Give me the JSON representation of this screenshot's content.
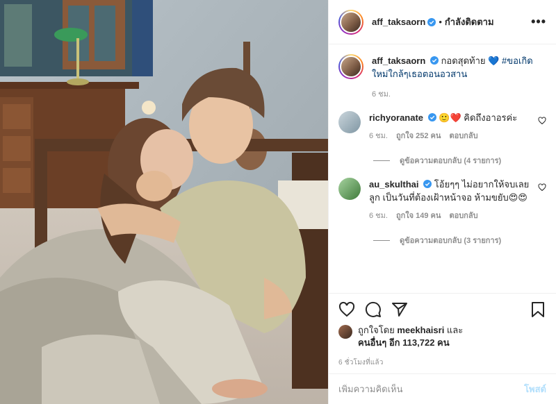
{
  "post": {
    "author": "aff_taksaorn",
    "follow_status": "กำลังติดตาม",
    "dot": "•",
    "more": "•••"
  },
  "caption": {
    "username": "aff_taksaorn",
    "text_before": "กอดสุดท้าย ",
    "heart": "💙",
    "hashtag": " #ขอเกิดใหม่ใกล้ๆเธอตอนอวสาน",
    "time": "6 ชม."
  },
  "comments": [
    {
      "username": "richyoranate",
      "text": " 🙂❤️ คิดถึงอาอรค่ะ",
      "time": "6 ชม.",
      "likes": "ถูกใจ 252 คน",
      "reply": "ตอบกลับ",
      "view_replies": "ดูข้อความตอบกลับ (4 รายการ)",
      "avatar_color": "#9fb3bf"
    },
    {
      "username": "au_skulthai",
      "text": " โอ้ยๆๆ ไม่อยากให้จบเลยลูก เป็นวันที่ต้องเฝ้าหน้าจอ ห้ามขยับ😍😍",
      "time": "6 ชม.",
      "likes": "ถูกใจ 149 คน",
      "reply": "ตอบกลับ",
      "view_replies": "ดูข้อความตอบกลับ (3 รายการ)",
      "avatar_color": "#6fa06a"
    }
  ],
  "likes": {
    "prefix": "ถูกใจโดย ",
    "user": "meekhaisri",
    "middle": " และ",
    "others": "คนอื่นๆ อีก 113,722 คน"
  },
  "posted_ago": "6 ชั่วโมงที่แล้ว",
  "add_comment": {
    "placeholder": "เพิ่มความคิดเห็น",
    "post_label": "โพสต์"
  },
  "colors": {
    "verified": "#3897f0",
    "link": "#00376b",
    "muted": "#8e8e8e",
    "post_button": "#b2dffc"
  },
  "icons": [
    "heart-icon",
    "comment-icon",
    "share-icon",
    "bookmark-icon",
    "verified-icon",
    "more-icon"
  ]
}
